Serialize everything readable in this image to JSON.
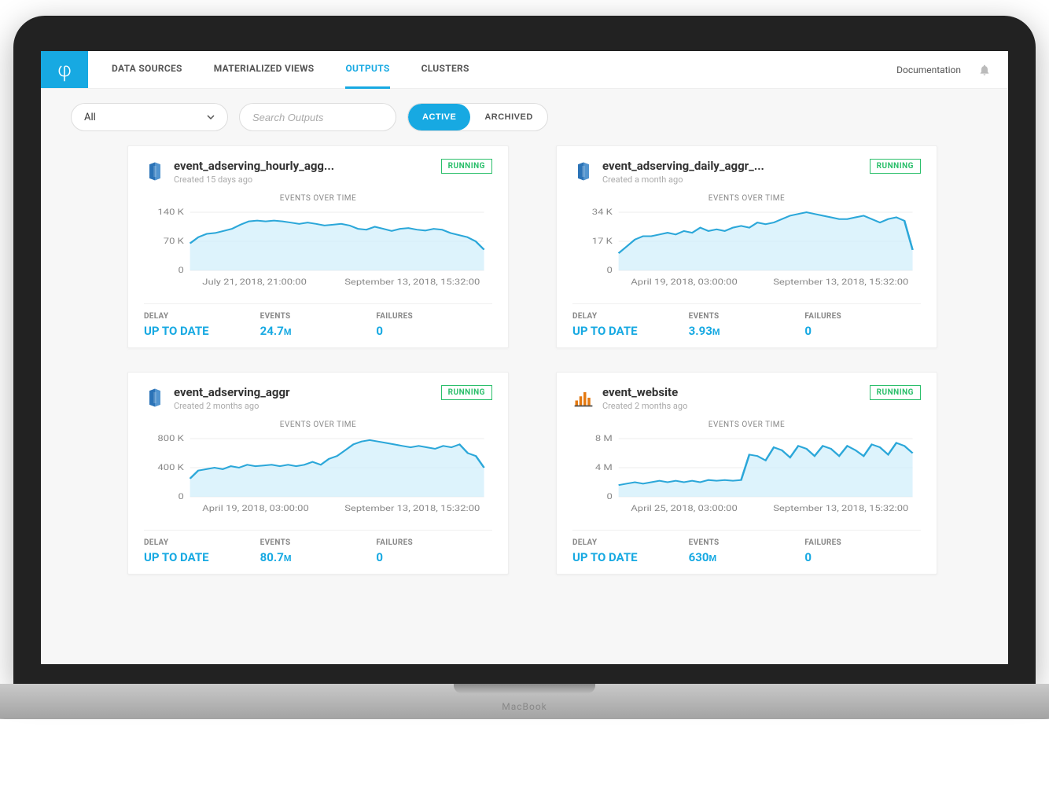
{
  "header": {
    "nav": [
      "DATA SOURCES",
      "MATERIALIZED VIEWS",
      "OUTPUTS",
      "CLUSTERS"
    ],
    "active_nav": 2,
    "documentation": "Documentation"
  },
  "toolbar": {
    "filter_selected": "All",
    "search_placeholder": "Search Outputs",
    "toggle": {
      "active": "ACTIVE",
      "archived": "ARCHIVED"
    }
  },
  "cards": [
    {
      "id": "hourly",
      "icon": "redshift",
      "title": "event_adserving_hourly_agg...",
      "created": "Created 15 days ago",
      "status": "RUNNING",
      "chart_title": "EVENTS OVER TIME",
      "stats": {
        "delay": "UP TO DATE",
        "events": "24.7",
        "events_unit": "M",
        "failures": "0"
      },
      "chart": {
        "type": "area",
        "ylabel_ticks": [
          "140 K",
          "70 K",
          "0"
        ],
        "x_left": "July 21, 2018, 21:00:00",
        "x_right": "September 13, 2018, 15:32:00",
        "ylim": [
          0,
          140
        ]
      }
    },
    {
      "id": "daily",
      "icon": "redshift",
      "title": "event_adserving_daily_aggr_...",
      "created": "Created a month ago",
      "status": "RUNNING",
      "chart_title": "EVENTS OVER TIME",
      "stats": {
        "delay": "UP TO DATE",
        "events": "3.93",
        "events_unit": "M",
        "failures": "0"
      },
      "chart": {
        "type": "area",
        "ylabel_ticks": [
          "34 K",
          "17 K",
          "0"
        ],
        "x_left": "April 19, 2018, 03:00:00",
        "x_right": "September 13, 2018, 15:32:00",
        "ylim": [
          0,
          34
        ]
      }
    },
    {
      "id": "aggr",
      "icon": "redshift",
      "title": "event_adserving_aggr",
      "created": "Created 2 months ago",
      "status": "RUNNING",
      "chart_title": "EVENTS OVER TIME",
      "stats": {
        "delay": "UP TO DATE",
        "events": "80.7",
        "events_unit": "M",
        "failures": "0"
      },
      "chart": {
        "type": "area",
        "ylabel_ticks": [
          "800 K",
          "400 K",
          "0"
        ],
        "x_left": "April 19, 2018, 03:00:00",
        "x_right": "September 13, 2018, 15:32:00",
        "ylim": [
          0,
          800
        ]
      }
    },
    {
      "id": "website",
      "icon": "athena",
      "title": "event_website",
      "created": "Created 2 months ago",
      "status": "RUNNING",
      "chart_title": "EVENTS OVER TIME",
      "stats": {
        "delay": "UP TO DATE",
        "events": "630",
        "events_unit": "M",
        "failures": "0"
      },
      "chart": {
        "type": "area",
        "ylabel_ticks": [
          "8 M",
          "4 M",
          "0"
        ],
        "x_left": "April 25, 2018, 03:00:00",
        "x_right": "September 13, 2018, 15:32:00",
        "ylim": [
          0,
          8
        ]
      }
    }
  ],
  "stat_labels": {
    "delay": "DELAY",
    "events": "EVENTS",
    "failures": "FAILURES"
  },
  "chart_data": [
    {
      "card": "event_adserving_hourly_agg",
      "type": "area",
      "title": "EVENTS OVER TIME",
      "ylabel": "",
      "ylim": [
        0,
        140000
      ],
      "y_ticks": [
        0,
        70000,
        140000
      ],
      "x_range": [
        "2018-07-21T21:00:00",
        "2018-09-13T15:32:00"
      ],
      "series": [
        {
          "name": "events",
          "approx_values_k": [
            65,
            80,
            88,
            90,
            95,
            100,
            110,
            118,
            120,
            118,
            120,
            118,
            115,
            112,
            115,
            112,
            108,
            110,
            112,
            108,
            100,
            98,
            105,
            100,
            95,
            100,
            102,
            98,
            96,
            100,
            98,
            90,
            85,
            80,
            70,
            50
          ]
        }
      ]
    },
    {
      "card": "event_adserving_daily_aggr",
      "type": "area",
      "title": "EVENTS OVER TIME",
      "ylabel": "",
      "ylim": [
        0,
        34000
      ],
      "y_ticks": [
        0,
        17000,
        34000
      ],
      "x_range": [
        "2018-04-19T03:00:00",
        "2018-09-13T15:32:00"
      ],
      "series": [
        {
          "name": "events",
          "approx_values_k": [
            10,
            14,
            18,
            20,
            20,
            21,
            22,
            21,
            23,
            22,
            25,
            23,
            24,
            23,
            25,
            26,
            25,
            28,
            27,
            28,
            30,
            32,
            33,
            34,
            33,
            32,
            31,
            30,
            30,
            31,
            32,
            30,
            28,
            30,
            31,
            29,
            12
          ]
        }
      ]
    },
    {
      "card": "event_adserving_aggr",
      "type": "area",
      "title": "EVENTS OVER TIME",
      "ylabel": "",
      "ylim": [
        0,
        800000
      ],
      "y_ticks": [
        0,
        400000,
        800000
      ],
      "x_range": [
        "2018-04-19T03:00:00",
        "2018-09-13T15:32:00"
      ],
      "series": [
        {
          "name": "events",
          "approx_values_k": [
            250,
            360,
            380,
            400,
            380,
            420,
            400,
            440,
            420,
            430,
            440,
            420,
            440,
            420,
            440,
            480,
            440,
            520,
            560,
            640,
            720,
            760,
            780,
            760,
            740,
            720,
            700,
            680,
            700,
            680,
            660,
            700,
            680,
            720,
            600,
            560,
            400
          ]
        }
      ]
    },
    {
      "card": "event_website",
      "type": "area",
      "title": "EVENTS OVER TIME",
      "ylabel": "",
      "ylim": [
        0,
        8000000
      ],
      "y_ticks": [
        0,
        4000000,
        8000000
      ],
      "x_range": [
        "2018-04-25T03:00:00",
        "2018-09-13T15:32:00"
      ],
      "series": [
        {
          "name": "events",
          "approx_values_m": [
            1.6,
            1.8,
            2.0,
            1.8,
            2.0,
            2.2,
            2.0,
            2.2,
            2.0,
            2.2,
            2.0,
            2.3,
            2.2,
            2.3,
            2.2,
            2.3,
            5.8,
            5.6,
            5.0,
            6.8,
            6.4,
            5.4,
            7.0,
            6.6,
            5.6,
            7.0,
            6.6,
            5.6,
            7.0,
            6.4,
            5.6,
            7.2,
            6.8,
            5.8,
            7.4,
            7.0,
            6.0
          ]
        }
      ]
    }
  ]
}
